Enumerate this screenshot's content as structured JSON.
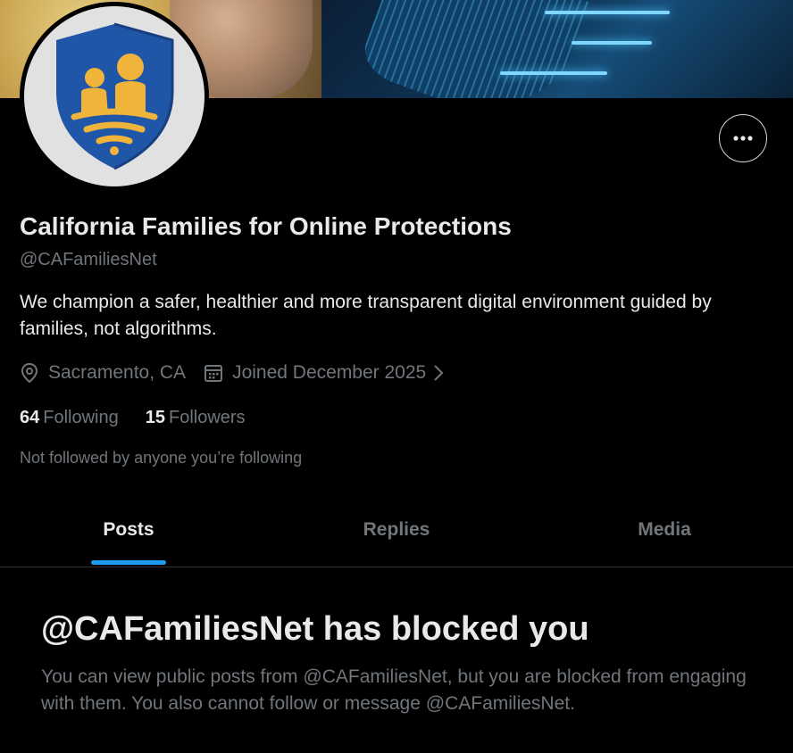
{
  "profile": {
    "name": "California Families for Online Protections",
    "handle": "@CAFamiliesNet",
    "bio": "We champion a safer, healthier and more transparent digital environment guided by families, not algorithms.",
    "location": "Sacramento, CA",
    "joined": "Joined December 2025",
    "following_count": "64",
    "following_label": "Following",
    "followers_count": "15",
    "followers_label": "Followers",
    "mutuals_note": "Not followed by anyone you’re following"
  },
  "tabs": [
    {
      "label": "Posts",
      "active": true
    },
    {
      "label": "Replies",
      "active": false
    },
    {
      "label": "Media",
      "active": false
    }
  ],
  "blocked": {
    "title": "@CAFamiliesNet has blocked you",
    "body": "You can view public posts from @CAFamiliesNet, but you are blocked from engaging with them. You also cannot follow or message @CAFamiliesNet."
  },
  "icons": {
    "location": "location-pin-icon",
    "calendar": "calendar-icon",
    "chevron": "chevron-right-icon",
    "more": "more-horizontal-icon"
  },
  "colors": {
    "background": "#000000",
    "primary_text": "#e7e9ea",
    "secondary_text": "#71767b",
    "accent": "#1d9bf0",
    "shield_blue": "#1f56a8",
    "shield_gold": "#f0b43a"
  }
}
